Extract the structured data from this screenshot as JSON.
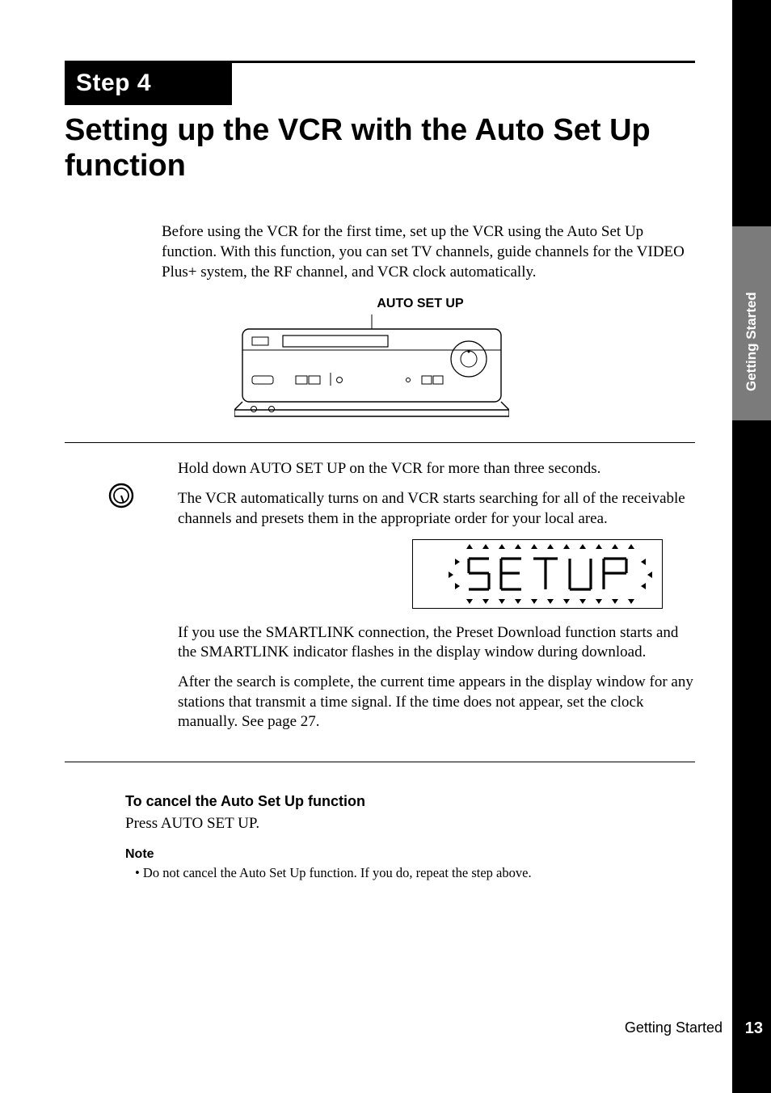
{
  "step_label": "Step 4",
  "title": "Setting up the VCR with the Auto Set Up function",
  "intro": "Before using the VCR for the first time, set up the VCR using the Auto Set Up function. With this function, you can set TV channels, guide channels for the VIDEO Plus+ system, the RF channel, and VCR clock automatically.",
  "vcr_label": "AUTO SET UP",
  "step": {
    "p1": "Hold down AUTO SET UP on the VCR for more than three seconds.",
    "p2": "The VCR automatically turns on and VCR starts searching for all of the receivable channels and presets them in the appropriate order for your local area.",
    "p3": "If you use the SMARTLINK connection, the Preset Download function starts and the SMARTLINK indicator flashes in the display window during download.",
    "p4": "After the search is complete, the current time appears in the display window for any stations that transmit a time signal.  If the time does not appear, set the clock manually.  See page 27."
  },
  "lcd_text": "SETUP",
  "after": {
    "cancel_h": "To cancel the Auto Set Up function",
    "cancel_body": "Press AUTO SET UP.",
    "note_h": "Note",
    "note_item": "Do not cancel the Auto Set Up function. If you do, repeat the step above."
  },
  "footer": {
    "section": "Getting Started",
    "page": "13"
  },
  "side_tab": "Getting Started"
}
